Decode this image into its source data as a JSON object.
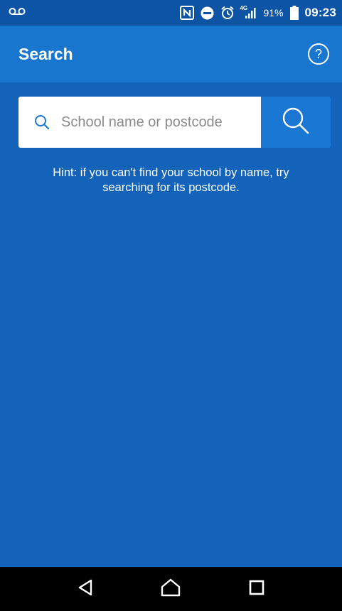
{
  "status_bar": {
    "battery_percent": "91%",
    "time": "09:23",
    "network": "4G",
    "icons": [
      "voicemail-icon",
      "nfc-icon",
      "do-not-disturb-icon",
      "alarm-icon",
      "signal-icon",
      "battery-icon"
    ]
  },
  "app_bar": {
    "title": "Search",
    "help_label": "?"
  },
  "search": {
    "placeholder": "School name or postcode",
    "value": ""
  },
  "hint": "Hint: if you can't find your school by name, try searching for its postcode.",
  "nav_bar": {
    "icons": [
      "back-icon",
      "home-icon",
      "recents-icon"
    ]
  },
  "colors": {
    "background": "#1463bb",
    "app_bar": "#1976cf",
    "status_bar": "#0d55a4",
    "search_button": "#1a77d3",
    "search_icon_accent": "#1a77d3"
  }
}
